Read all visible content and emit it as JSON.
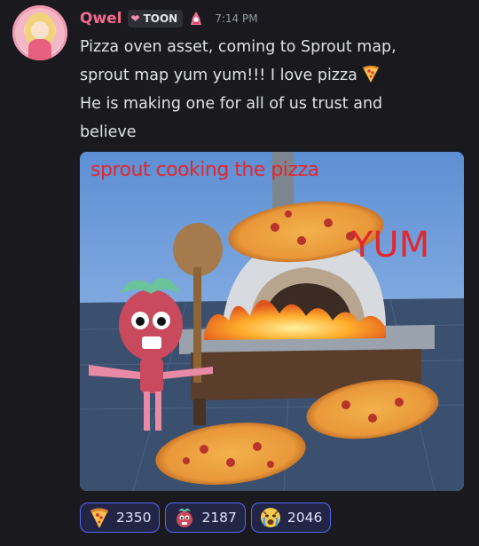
{
  "message": {
    "username": "Qwel",
    "tag_label": "TOON",
    "timestamp": "7:14 PM",
    "lines": [
      "Pizza oven asset, coming to Sprout map,",
      "sprout map yum yum!!! I love pizza",
      "He is making one for all of us trust and",
      "believe"
    ]
  },
  "attachment": {
    "caption_top": "sprout cooking the pizza",
    "caption_yum": "YUM"
  },
  "reactions": [
    {
      "icon": "pizza-icon",
      "count": "2350"
    },
    {
      "icon": "sprout-toon-icon",
      "count": "2187"
    },
    {
      "icon": "crying-face-icon",
      "count": "2046"
    }
  ],
  "colors": {
    "username": "#f36b8e",
    "background": "#1a1a1e",
    "reaction_border": "#5865f2",
    "caption_red": "#e0282d"
  }
}
